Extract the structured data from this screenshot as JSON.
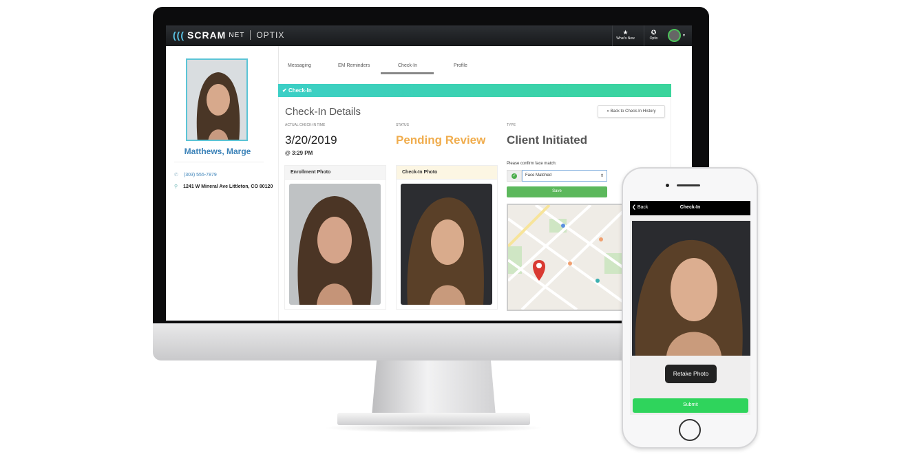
{
  "app": {
    "brand": "SCRAM",
    "brand_suffix": "NET",
    "product": "OPTIX"
  },
  "header": {
    "whats_new": "What's New",
    "optix": "Optix",
    "icons": {
      "whats_new": "star-icon",
      "optix": "brain-icon",
      "avatar": "user-avatar-icon"
    }
  },
  "client": {
    "name": "Matthews, Marge",
    "phone": "(303) 555-7879",
    "address": "1241 W Mineral Ave Littleton, CO 80120"
  },
  "tabs": [
    {
      "label": "Messaging"
    },
    {
      "label": "EM Reminders"
    },
    {
      "label": "Check-In",
      "active": true
    },
    {
      "label": "Profile"
    }
  ],
  "section": {
    "title": "Check-In"
  },
  "details": {
    "title": "Check-In Details",
    "back_label": "« Back to Check-In History",
    "time_label": "Actual Check-In Time",
    "date": "3/20/2019",
    "time": "@ 3:29 PM",
    "status_label": "Status",
    "status": "Pending Review",
    "type_label": "Type",
    "type": "Client Initiated",
    "enrollment_photo": "Enrollment Photo",
    "checkin_photo": "Check-In Photo",
    "confirm_label": "Please confirm face match:",
    "face_match_value": "Face Matched",
    "save_label": "Save"
  },
  "phone": {
    "back": "Back",
    "title": "Check-In",
    "retake": "Retake Photo",
    "submit": "Submit"
  },
  "colors": {
    "accent_teal": "#3ccfc6",
    "status_pending": "#f0ad4e",
    "name_blue": "#3b82b8",
    "save_green": "#5cb85c",
    "submit_green": "#2fd45c"
  }
}
